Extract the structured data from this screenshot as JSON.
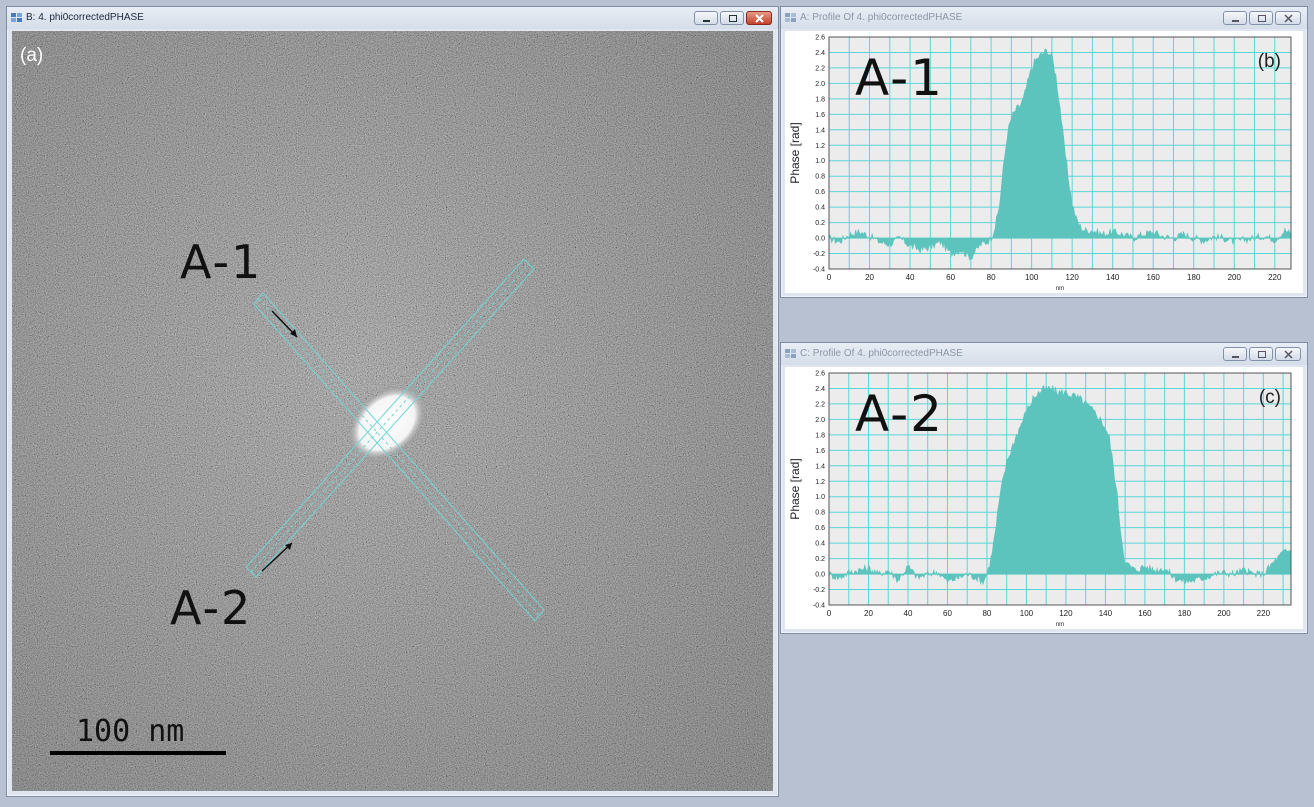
{
  "windows": {
    "image": {
      "title": "B: 4. phi0correctedPHASE"
    },
    "profile_a": {
      "title": "A: Profile Of 4. phi0correctedPHASE"
    },
    "profile_c": {
      "title": "C: Profile Of 4. phi0correctedPHASE"
    }
  },
  "image_panel": {
    "panel_label": "(a)",
    "label_a1": "A-1",
    "label_a2": "A-2",
    "scalebar_label": "100 nm"
  },
  "colors": {
    "fill": "#5cc4bc",
    "grid": "#5ad6d8",
    "plot_bg": "#ececec",
    "roi": "#6fd6d6"
  },
  "chart_data": [
    {
      "type": "area",
      "label": "A-1",
      "panel_label": "(b)",
      "ylabel": "Phase [rad]",
      "xlabel": "nm",
      "xlim": [
        0,
        228
      ],
      "ylim": [
        -0.4,
        2.6
      ],
      "x_ticks": [
        0,
        20,
        40,
        60,
        80,
        100,
        120,
        140,
        160,
        180,
        200,
        220
      ],
      "y_ticks": [
        -0.4,
        -0.2,
        0.0,
        0.2,
        0.4,
        0.6,
        0.8,
        1.0,
        1.2,
        1.4,
        1.6,
        1.8,
        2.0,
        2.2,
        2.4,
        2.6
      ],
      "x": [
        0,
        5,
        10,
        15,
        20,
        25,
        30,
        35,
        40,
        45,
        50,
        55,
        60,
        65,
        70,
        75,
        78,
        80,
        82,
        84,
        86,
        88,
        90,
        92,
        94,
        96,
        98,
        100,
        102,
        104,
        106,
        108,
        110,
        112,
        114,
        116,
        118,
        120,
        122,
        124,
        126,
        130,
        135,
        140,
        145,
        150,
        155,
        160,
        165,
        170,
        175,
        180,
        185,
        190,
        195,
        200,
        205,
        210,
        215,
        220,
        225,
        228
      ],
      "y": [
        0.0,
        -0.05,
        0.05,
        0.08,
        0.03,
        -0.05,
        -0.08,
        0.0,
        -0.1,
        -0.15,
        -0.12,
        -0.05,
        -0.2,
        -0.15,
        -0.25,
        -0.08,
        -0.05,
        0.0,
        0.15,
        0.4,
        0.9,
        1.35,
        1.55,
        1.65,
        1.7,
        1.8,
        2.0,
        2.2,
        2.3,
        2.35,
        2.4,
        2.42,
        2.35,
        2.1,
        1.7,
        1.2,
        0.8,
        0.45,
        0.25,
        0.15,
        0.1,
        0.1,
        0.05,
        0.08,
        0.05,
        0.0,
        0.05,
        0.08,
        0.02,
        0.0,
        0.05,
        0.0,
        -0.03,
        0.02,
        0.0,
        -0.05,
        -0.02,
        0.0,
        0.03,
        -0.02,
        0.1,
        0.05
      ]
    },
    {
      "type": "area",
      "label": "A-2",
      "panel_label": "(c)",
      "ylabel": "Phase [rad]",
      "xlabel": "nm",
      "xlim": [
        0,
        234
      ],
      "ylim": [
        -0.4,
        2.6
      ],
      "x_ticks": [
        0,
        20,
        40,
        60,
        80,
        100,
        120,
        140,
        160,
        180,
        200,
        220
      ],
      "y_ticks": [
        -0.4,
        -0.2,
        0.0,
        0.2,
        0.4,
        0.6,
        0.8,
        1.0,
        1.2,
        1.4,
        1.6,
        1.8,
        2.0,
        2.2,
        2.4,
        2.6
      ],
      "x": [
        0,
        5,
        10,
        15,
        20,
        25,
        30,
        35,
        40,
        45,
        50,
        55,
        60,
        65,
        70,
        75,
        78,
        80,
        82,
        84,
        86,
        88,
        90,
        95,
        100,
        104,
        108,
        112,
        116,
        120,
        124,
        128,
        132,
        136,
        140,
        142,
        144,
        146,
        148,
        150,
        155,
        160,
        165,
        170,
        175,
        180,
        185,
        190,
        195,
        200,
        205,
        210,
        215,
        220,
        225,
        230,
        234
      ],
      "y": [
        0.0,
        -0.05,
        0.02,
        0.05,
        0.08,
        0.0,
        0.05,
        -0.08,
        0.1,
        -0.05,
        0.0,
        0.03,
        -0.1,
        -0.05,
        0.0,
        -0.05,
        -0.1,
        0.0,
        0.2,
        0.5,
        0.9,
        1.2,
        1.45,
        1.8,
        2.1,
        2.3,
        2.38,
        2.4,
        2.35,
        2.35,
        2.3,
        2.25,
        2.15,
        2.05,
        1.9,
        1.75,
        1.4,
        1.0,
        0.5,
        0.15,
        0.05,
        0.1,
        0.05,
        0.08,
        -0.05,
        -0.1,
        -0.08,
        -0.05,
        0.0,
        0.02,
        0.0,
        0.05,
        0.0,
        0.0,
        0.15,
        0.28,
        0.3
      ]
    }
  ]
}
